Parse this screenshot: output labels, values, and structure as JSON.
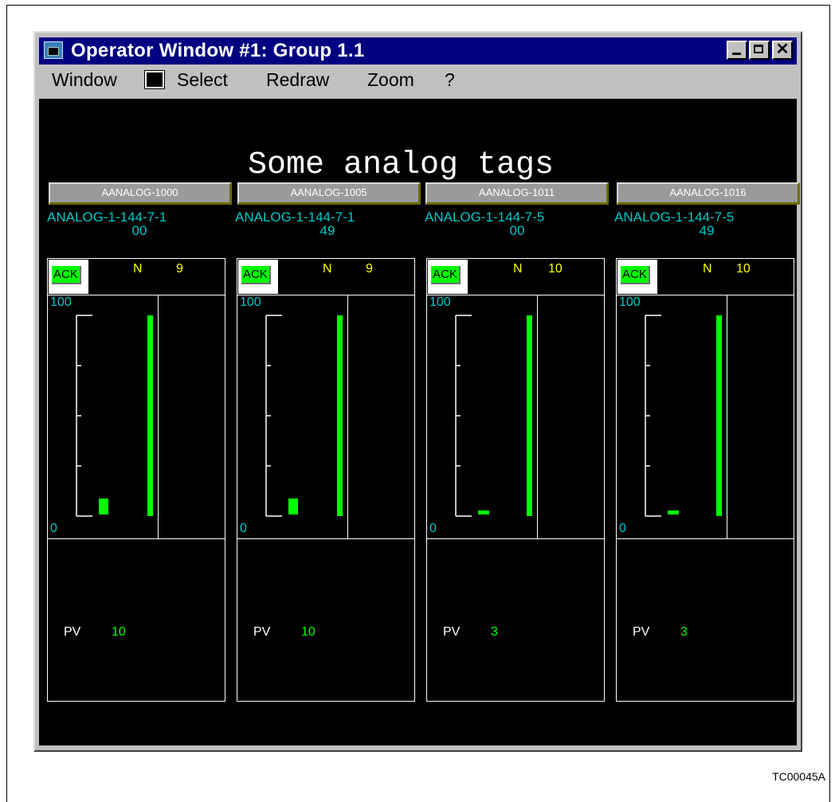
{
  "window": {
    "title": "Operator Window #1: Group 1.1",
    "menu": [
      "Window",
      "Select",
      "Redraw",
      "Zoom",
      "?"
    ]
  },
  "display_title": "Some analog tags",
  "faceplates": [
    {
      "tag": "AANALOG-1000",
      "desc_line1": "ANALOG-1-144-7-1",
      "desc_line2": "00",
      "ack": "ACK",
      "mode": "N",
      "mode_count": "9",
      "scale_hi": "100",
      "scale_lo": "0",
      "pv_label": "PV",
      "pv": "10",
      "bar_fraction": 0.08
    },
    {
      "tag": "AANALOG-1005",
      "desc_line1": "ANALOG-1-144-7-1",
      "desc_line2": "49",
      "ack": "ACK",
      "mode": "N",
      "mode_count": "9",
      "scale_hi": "100",
      "scale_lo": "0",
      "pv_label": "PV",
      "pv": "10",
      "bar_fraction": 0.08
    },
    {
      "tag": "AANALOG-1011",
      "desc_line1": "ANALOG-1-144-7-5",
      "desc_line2": "00",
      "ack": "ACK",
      "mode": "N",
      "mode_count": "10",
      "scale_hi": "100",
      "scale_lo": "0",
      "pv_label": "PV",
      "pv": "3",
      "bar_fraction": 0.02
    },
    {
      "tag": "AANALOG-1016",
      "desc_line1": "ANALOG-1-144-7-5",
      "desc_line2": "49",
      "ack": "ACK",
      "mode": "N",
      "mode_count": "10",
      "scale_hi": "100",
      "scale_lo": "0",
      "pv_label": "PV",
      "pv": "3",
      "bar_fraction": 0.02
    }
  ],
  "figure_id": "TC00045A",
  "colors": {
    "title_bar": "#000080",
    "canvas": "#000000",
    "bar": "#00ff00",
    "desc": "#00c8c8",
    "mode": "#ffff00"
  }
}
